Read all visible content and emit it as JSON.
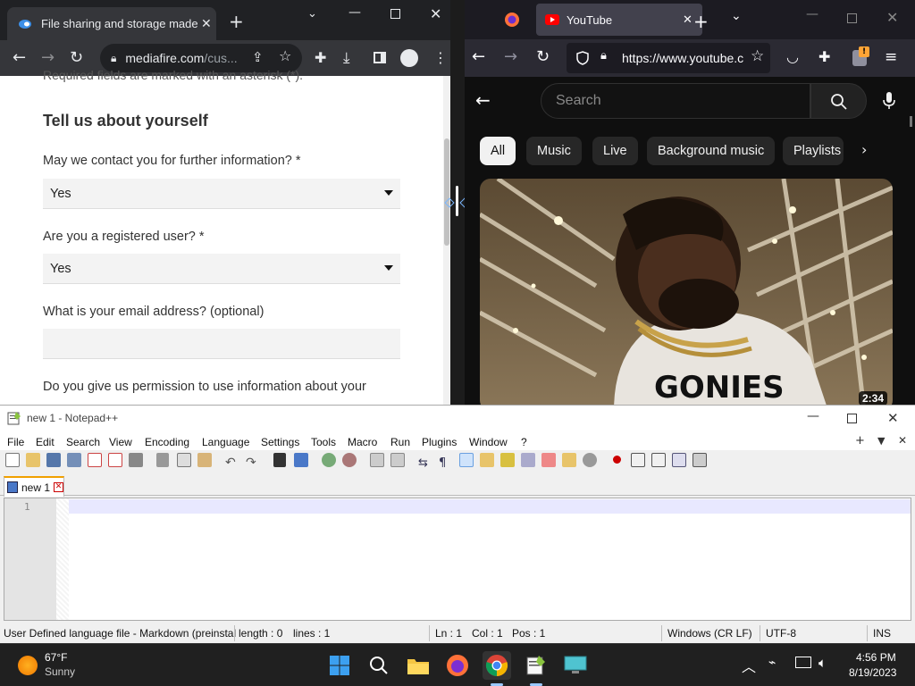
{
  "chrome": {
    "tab_title": "File sharing and storage made s",
    "url_host": "mediafire.com",
    "url_path": "/cus...",
    "form": {
      "top_cut_text": "Required fields are marked with an asterisk (*).",
      "heading": "Tell us about yourself",
      "q1_label": "May we contact you for further information? *",
      "q1_value": "Yes",
      "q2_label": "Are you a registered user? *",
      "q2_value": "Yes",
      "q3_label": "What is your email address? (optional)",
      "q3_value": "",
      "q4_label": "Do you give us permission to use information about your"
    }
  },
  "firefox": {
    "tab_title": "YouTube",
    "url": "https://www.youtube.c",
    "notification_badge": "!",
    "search_placeholder": "Search",
    "chips": [
      "All",
      "Music",
      "Live",
      "Background music",
      "Playlists"
    ],
    "video_duration": "2:34"
  },
  "notepad": {
    "title": "new 1 - Notepad++",
    "menu": [
      "File",
      "Edit",
      "Search",
      "View",
      "Encoding",
      "Language",
      "Settings",
      "Tools",
      "Macro",
      "Run",
      "Plugins",
      "Window",
      "?"
    ],
    "doc_tab": "new 1",
    "line_number": "1",
    "status": {
      "language": "User Defined language file - Markdown (preinstal",
      "length": "length : 0",
      "lines": "lines : 1",
      "ln": "Ln : 1",
      "col": "Col : 1",
      "pos": "Pos : 1",
      "eol": "Windows (CR LF)",
      "encoding": "UTF-8",
      "mode": "INS"
    }
  },
  "taskbar": {
    "weather_temp": "67°F",
    "weather_desc": "Sunny",
    "time": "4:56 PM",
    "date": "8/19/2023"
  },
  "colors": {
    "chrome_dark": "#202124",
    "youtube_red": "#ff0000",
    "firefox_bg": "#1c1b22",
    "accent_blue": "#1a73e8"
  }
}
